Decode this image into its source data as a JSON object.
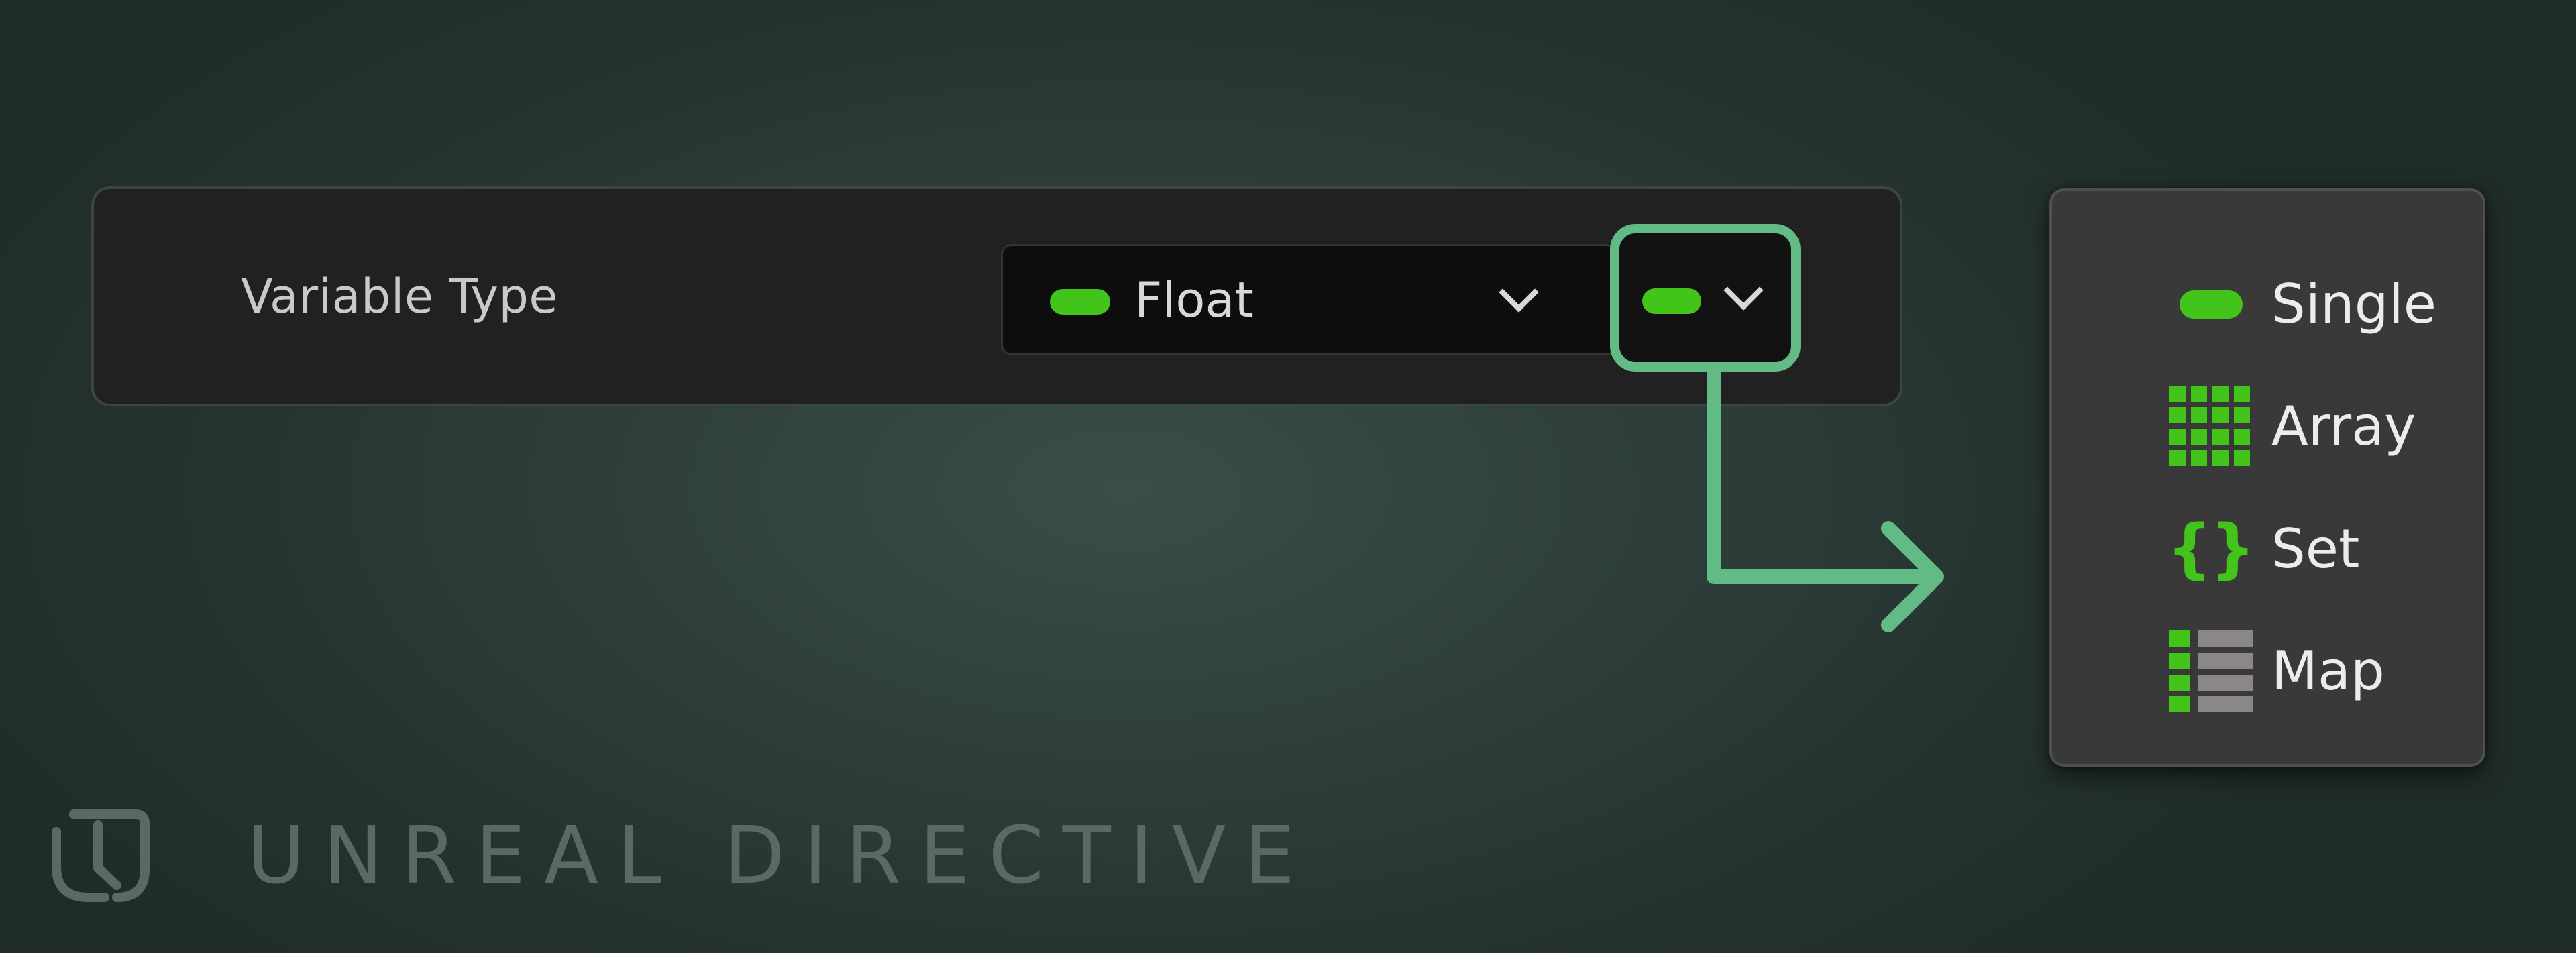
{
  "property": {
    "label": "Variable Type",
    "selected_type": "Float",
    "type_color": "#43c41a"
  },
  "container_button": {
    "icon": "single-pill-icon",
    "accent": "#62ba85"
  },
  "container_menu": {
    "items": [
      {
        "label": "Single",
        "icon": "single-pill-icon"
      },
      {
        "label": "Array",
        "icon": "array-grid-icon"
      },
      {
        "label": "Set",
        "icon": "set-braces-icon",
        "glyph": "{}"
      },
      {
        "label": "Map",
        "icon": "map-list-icon"
      }
    ]
  },
  "watermark": {
    "text": "UNREAL DIRECTIVE"
  }
}
